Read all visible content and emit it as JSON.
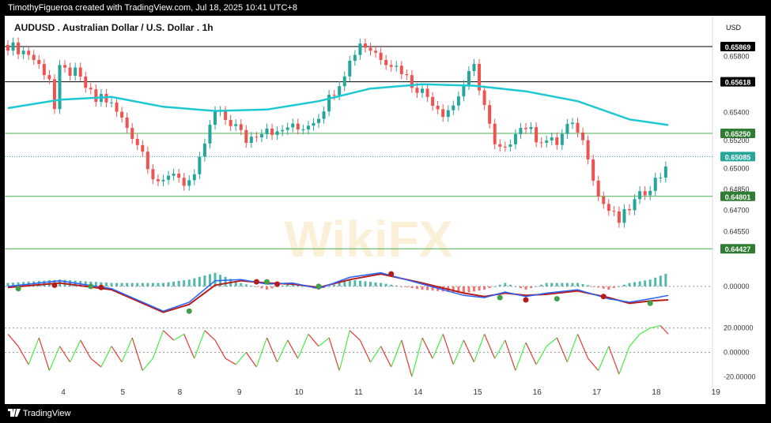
{
  "header": {
    "attribution": "TimothyFigueroa created with TradingView.com, Jul 18, 2025 10:41 UTC+8"
  },
  "footer": {
    "brand": "TradingView",
    "brand_icon": "tradingview-logo-icon"
  },
  "watermark": {
    "text": "WikiFX"
  },
  "colors": {
    "up": "#26a69a",
    "down": "#ef5350",
    "ma": "#1ec8d2",
    "macd": "#2962ff",
    "signal": "#b71c1c",
    "rsi_up": "#44ee44",
    "rsi_down": "#e53935",
    "level_line": "#4caf50"
  },
  "chart_data": [
    {
      "type": "candlestick",
      "title": "AUDUSD . Australian Dollar / U.S. Dollar . 1h",
      "currency": "USD",
      "x_ticks": [
        "4",
        "5",
        "8",
        "9",
        "10",
        "11",
        "14",
        "15",
        "16",
        "17",
        "18",
        "19"
      ],
      "y_ticks": [
        "0.65800",
        "0.65400",
        "0.65200",
        "0.65000",
        "0.64850",
        "0.64700",
        "0.64550"
      ],
      "ylim": [
        0.644,
        0.6592
      ],
      "price_path": [
        [
          0,
          0.6588
        ],
        [
          4,
          0.6582
        ],
        [
          8,
          0.6565
        ],
        [
          9,
          0.6542
        ],
        [
          10,
          0.657
        ],
        [
          13,
          0.6568
        ],
        [
          15,
          0.6558
        ],
        [
          17,
          0.6548
        ],
        [
          18,
          0.6552
        ],
        [
          20,
          0.6545
        ],
        [
          22,
          0.6535
        ],
        [
          24,
          0.6524
        ],
        [
          26,
          0.6512
        ],
        [
          28,
          0.6495
        ],
        [
          30,
          0.6488
        ],
        [
          32,
          0.6498
        ],
        [
          34,
          0.649
        ],
        [
          36,
          0.6492
        ],
        [
          38,
          0.6518
        ],
        [
          40,
          0.654
        ],
        [
          42,
          0.6535
        ],
        [
          44,
          0.653
        ],
        [
          46,
          0.652
        ],
        [
          48,
          0.6525
        ],
        [
          50,
          0.653
        ],
        [
          52,
          0.6524
        ],
        [
          54,
          0.653
        ],
        [
          56,
          0.6528
        ],
        [
          58,
          0.6532
        ],
        [
          60,
          0.6538
        ],
        [
          62,
          0.655
        ],
        [
          64,
          0.6562
        ],
        [
          66,
          0.6576
        ],
        [
          68,
          0.659
        ],
        [
          70,
          0.6585
        ],
        [
          72,
          0.658
        ],
        [
          74,
          0.6575
        ],
        [
          76,
          0.657
        ],
        [
          78,
          0.656
        ],
        [
          80,
          0.6555
        ],
        [
          82,
          0.6548
        ],
        [
          84,
          0.654
        ],
        [
          86,
          0.6545
        ],
        [
          88,
          0.656
        ],
        [
          90,
          0.6572
        ],
        [
          92,
          0.6545
        ],
        [
          94,
          0.6515
        ],
        [
          96,
          0.6512
        ],
        [
          98,
          0.6528
        ],
        [
          100,
          0.653
        ],
        [
          102,
          0.6522
        ],
        [
          104,
          0.652
        ],
        [
          106,
          0.6518
        ],
        [
          108,
          0.653
        ],
        [
          110,
          0.6528
        ],
        [
          112,
          0.651
        ],
        [
          114,
          0.648
        ],
        [
          116,
          0.647
        ],
        [
          118,
          0.6462
        ],
        [
          120,
          0.6472
        ],
        [
          122,
          0.648
        ],
        [
          124,
          0.6488
        ],
        [
          126,
          0.6495
        ],
        [
          127.5,
          0.6508
        ]
      ],
      "moving_average": [
        [
          0,
          0.6543
        ],
        [
          10,
          0.6549
        ],
        [
          20,
          0.6551
        ],
        [
          30,
          0.6544
        ],
        [
          40,
          0.6541
        ],
        [
          50,
          0.6542
        ],
        [
          60,
          0.6548
        ],
        [
          70,
          0.6557
        ],
        [
          80,
          0.656
        ],
        [
          90,
          0.6559
        ],
        [
          100,
          0.6555
        ],
        [
          110,
          0.6548
        ],
        [
          120,
          0.6535
        ],
        [
          127.5,
          0.6531
        ]
      ],
      "levels": [
        {
          "label": "0.65869",
          "value": 0.65869,
          "bg": "#000000",
          "line": "#000000"
        },
        {
          "label": "0.65618",
          "value": 0.65618,
          "bg": "#000000",
          "line": "#000000"
        },
        {
          "label": "0.65250",
          "value": 0.6525,
          "bg": "#2e7d32",
          "line": "#4caf50"
        },
        {
          "label": "0.65085",
          "value": 0.65085,
          "bg": "#26a69a",
          "line": "#26a69a"
        },
        {
          "label": "0.64801",
          "value": 0.64801,
          "bg": "#2e7d32",
          "line": "#4caf50"
        },
        {
          "label": "0.64427",
          "value": 0.64427,
          "bg": "#2e7d32",
          "line": "#4caf50"
        }
      ]
    },
    {
      "type": "macd",
      "y_ticks": [
        "0.00000"
      ],
      "macd": [
        [
          0,
          0.0
        ],
        [
          10,
          0.5
        ],
        [
          20,
          -0.2
        ],
        [
          30,
          -2.2
        ],
        [
          35,
          -1.4
        ],
        [
          40,
          0.5
        ],
        [
          45,
          0.6
        ],
        [
          50,
          0.2
        ],
        [
          55,
          0.3
        ],
        [
          60,
          -0.2
        ],
        [
          66,
          0.8
        ],
        [
          72,
          1.2
        ],
        [
          80,
          0.2
        ],
        [
          88,
          -0.8
        ],
        [
          92,
          -1.0
        ],
        [
          96,
          -0.5
        ],
        [
          100,
          -0.9
        ],
        [
          104,
          -0.6
        ],
        [
          110,
          -0.3
        ],
        [
          116,
          -1.1
        ],
        [
          120,
          -1.4
        ],
        [
          124,
          -1.1
        ],
        [
          127.5,
          -0.8
        ]
      ],
      "signal": [
        [
          0,
          -0.1
        ],
        [
          10,
          0.3
        ],
        [
          20,
          -0.3
        ],
        [
          30,
          -2.3
        ],
        [
          35,
          -1.6
        ],
        [
          40,
          0.1
        ],
        [
          45,
          0.5
        ],
        [
          50,
          0.3
        ],
        [
          55,
          0.2
        ],
        [
          60,
          -0.1
        ],
        [
          66,
          0.6
        ],
        [
          72,
          1.1
        ],
        [
          80,
          0.3
        ],
        [
          88,
          -0.6
        ],
        [
          92,
          -0.9
        ],
        [
          96,
          -0.6
        ],
        [
          100,
          -0.8
        ],
        [
          104,
          -0.7
        ],
        [
          110,
          -0.4
        ],
        [
          116,
          -1.0
        ],
        [
          120,
          -1.5
        ],
        [
          124,
          -1.3
        ],
        [
          127.5,
          -1.2
        ]
      ],
      "histogram": [
        [
          56,
          0.1
        ],
        [
          58,
          0.1
        ],
        [
          61,
          0.1
        ],
        [
          64,
          0.08
        ],
        [
          96,
          0.2
        ],
        [
          100,
          0.2
        ],
        [
          108,
          0.1
        ],
        [
          110,
          0.15
        ],
        [
          124,
          0.3
        ],
        [
          126,
          0.5
        ],
        [
          127.5,
          0.7
        ]
      ],
      "cross_points": [
        {
          "x": 2,
          "y": -0.2,
          "state": "up"
        },
        {
          "x": 9,
          "y": 0.1,
          "state": "down"
        },
        {
          "x": 16,
          "y": 0.0,
          "state": "up"
        },
        {
          "x": 18,
          "y": -0.1,
          "state": "down"
        },
        {
          "x": 35,
          "y": -2.2,
          "state": "up"
        },
        {
          "x": 48,
          "y": 0.4,
          "state": "down"
        },
        {
          "x": 50,
          "y": 0.4,
          "state": "up"
        },
        {
          "x": 52,
          "y": 0.2,
          "state": "down"
        },
        {
          "x": 60,
          "y": 0.0,
          "state": "up"
        },
        {
          "x": 74,
          "y": 1.1,
          "state": "down"
        },
        {
          "x": 95,
          "y": -1.0,
          "state": "up"
        },
        {
          "x": 100,
          "y": -1.2,
          "state": "down"
        },
        {
          "x": 106,
          "y": -1.1,
          "state": "up"
        },
        {
          "x": 115,
          "y": -0.9,
          "state": "down"
        },
        {
          "x": 124,
          "y": -1.5,
          "state": "up"
        }
      ],
      "ylim": [
        -2.6,
        1.6
      ]
    },
    {
      "type": "oscillator",
      "y_ticks": [
        "20.00000",
        "0.00000",
        "-20.00000"
      ],
      "ylim": [
        -25,
        25
      ],
      "series": [
        [
          0,
          15
        ],
        [
          2,
          5
        ],
        [
          4,
          -10
        ],
        [
          6,
          12
        ],
        [
          8,
          -15
        ],
        [
          10,
          5
        ],
        [
          12,
          -8
        ],
        [
          14,
          10
        ],
        [
          16,
          -5
        ],
        [
          18,
          -12
        ],
        [
          20,
          5
        ],
        [
          22,
          -8
        ],
        [
          24,
          12
        ],
        [
          26,
          -15
        ],
        [
          28,
          -5
        ],
        [
          30,
          18
        ],
        [
          32,
          10
        ],
        [
          34,
          15
        ],
        [
          36,
          -5
        ],
        [
          38,
          18
        ],
        [
          40,
          10
        ],
        [
          42,
          -5
        ],
        [
          44,
          -10
        ],
        [
          46,
          0
        ],
        [
          48,
          -12
        ],
        [
          50,
          12
        ],
        [
          52,
          -8
        ],
        [
          54,
          10
        ],
        [
          56,
          -5
        ],
        [
          58,
          15
        ],
        [
          60,
          5
        ],
        [
          62,
          12
        ],
        [
          64,
          -15
        ],
        [
          66,
          18
        ],
        [
          68,
          10
        ],
        [
          70,
          -8
        ],
        [
          72,
          5
        ],
        [
          74,
          -12
        ],
        [
          76,
          10
        ],
        [
          78,
          -20
        ],
        [
          80,
          12
        ],
        [
          82,
          -5
        ],
        [
          84,
          15
        ],
        [
          86,
          -10
        ],
        [
          88,
          10
        ],
        [
          90,
          -8
        ],
        [
          92,
          15
        ],
        [
          94,
          -5
        ],
        [
          96,
          10
        ],
        [
          98,
          -15
        ],
        [
          100,
          8
        ],
        [
          102,
          -10
        ],
        [
          104,
          5
        ],
        [
          106,
          12
        ],
        [
          108,
          -8
        ],
        [
          110,
          15
        ],
        [
          112,
          -5
        ],
        [
          114,
          -15
        ],
        [
          116,
          5
        ],
        [
          118,
          -18
        ],
        [
          120,
          5
        ],
        [
          122,
          15
        ],
        [
          124,
          20
        ],
        [
          126,
          22
        ],
        [
          127.5,
          15
        ]
      ]
    }
  ]
}
